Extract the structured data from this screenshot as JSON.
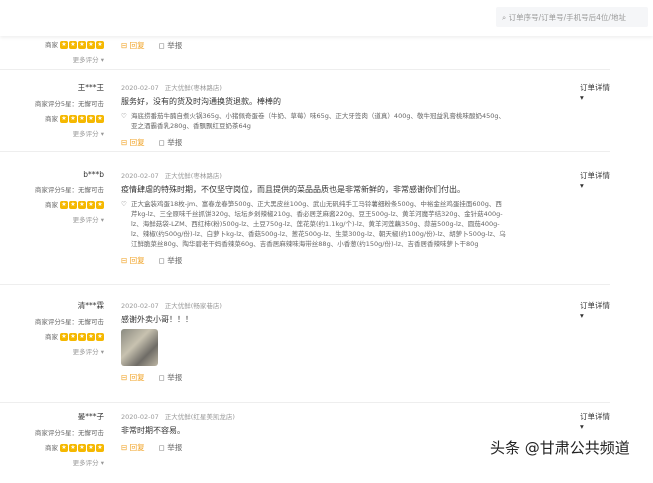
{
  "header": {
    "search_placeholder": "订单序号/订单号/手机号后4位/地址"
  },
  "labels": {
    "merchant": "商家",
    "more_ratings": "更多评分 ▾",
    "reply": "回复",
    "report": "举报",
    "order_detail": "订单详情 ▾",
    "score_prefix": "商家评分5星：无懈可击"
  },
  "reviews": [
    {
      "user": "",
      "date": "",
      "store": "",
      "comment": "",
      "goods": ""
    },
    {
      "user": "王***王",
      "date": "2020-02-07",
      "store": "正大优鲜(枣林路店)",
      "comment": "服务好，没有的货及时沟通换货退款。棒棒的",
      "goods": "海底捞番茄牛腩自煮火锅365g、小猪佩奇蛋卷（牛奶、草莓）味65g、正大牙签肉（道真）400g、敬牛冠益乳膏桃味酸奶450g、亚之酒霸香乳280g、香飘飘红豆奶茶64g"
    },
    {
      "user": "b***b",
      "date": "2020-02-07",
      "store": "正大优鲜(枣林路店)",
      "comment": "疫情肆虐的特殊时期，不仅坚守岗位，而且提供的菜品品质也是非常新鲜的，非常感谢你们付出。",
      "goods": "正大盒装鸡蛋18枚-jm、富春龙春笋500g、正大黑皮丝100g、武山无矾纯手工马铃薯细粉条500g、中裕金丝鸡蛋挂面600g、西芹kg-lz、三全原味千丝抓饼320g、坛坛乡剁辣椒210g、香必居芝麻酱220g、豆王500g-lz、黄羊河魔芋结320g、金针菇400g-lz、海鲜菇袋-LZM、西红柿(粉)500g-lz、土豆750g-lz、莲花菜(约1.1kg/个)-lz、黄羊河莲藕350g、蒜苗500g-lz、圆茄400g-lz、辣椒(约500g/份)-lz、白萝卜kg-lz、香菇500g-lz、葱花500g-lz、生菜300g-lz、朝天椒(约100g/份)-lz、胡萝卜500g-lz、乌江鲜脆菜丝80g、陶华碧老干妈香辣菜60g、吉香居麻辣味海带丝88g、小香葱(约150g/份)-lz、吉香居香辣味萝卜干80g"
    },
    {
      "user": "清***霖",
      "date": "2020-02-07",
      "store": "正大优鲜(畅家巷店)",
      "comment": "感谢外卖小哥！！！",
      "goods": ""
    },
    {
      "user": "晏***子",
      "date": "2020-02-07",
      "store": "正大优鲜(红星美凯龙店)",
      "comment": "非常时期不容易。",
      "goods": ""
    }
  ],
  "watermark": "头条 @甘肃公共频道"
}
